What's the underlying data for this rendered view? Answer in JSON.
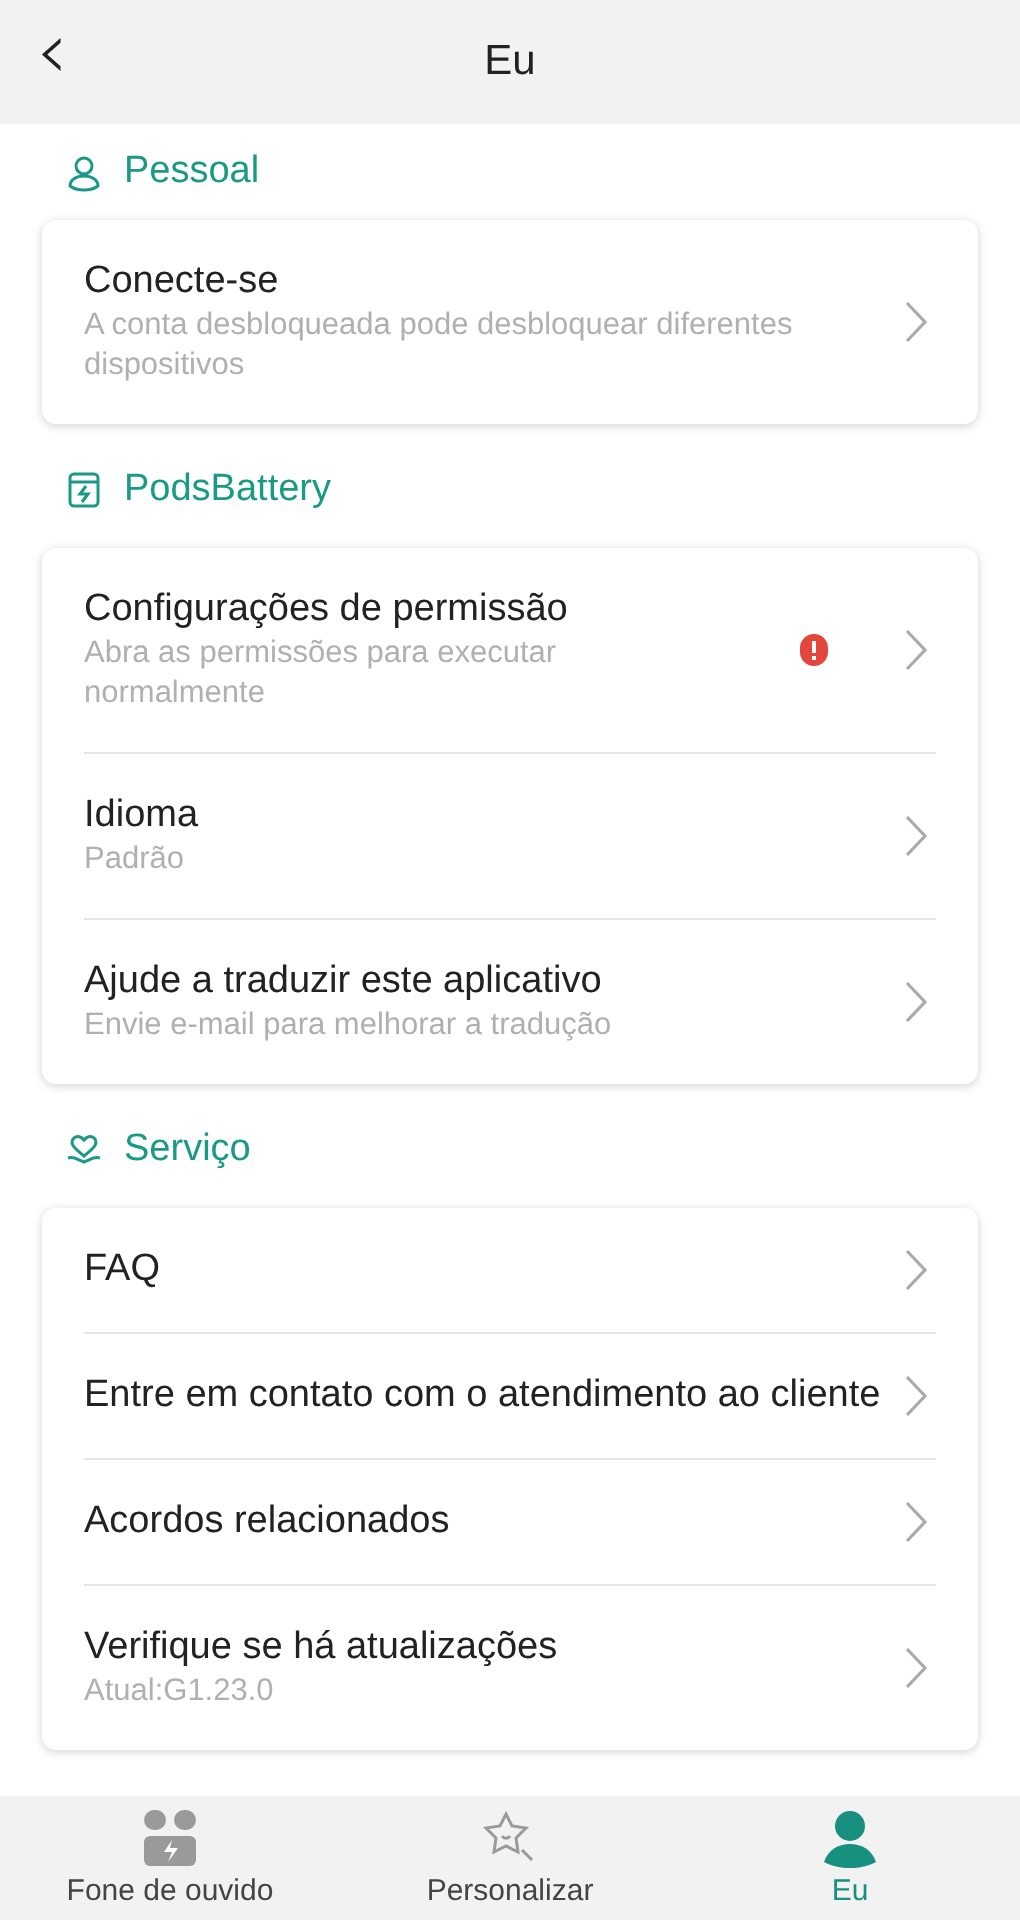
{
  "header": {
    "back": "‹",
    "title": "Eu"
  },
  "sections": [
    {
      "kind": "person",
      "title": "Pessoal",
      "items": [
        {
          "title": "Conecte-se",
          "subtitle": "A conta desbloqueada pode desbloquear diferentes dispositivos",
          "alert": false
        }
      ]
    },
    {
      "kind": "battery",
      "title": "PodsBattery",
      "items": [
        {
          "title": "Configurações de permissão",
          "subtitle": "Abra as permissões para executar normalmente",
          "alert": true
        },
        {
          "title": "Idioma",
          "subtitle": "Padrão",
          "alert": false
        },
        {
          "title": "Ajude a traduzir este aplicativo",
          "subtitle": "Envie e-mail para melhorar a tradução",
          "alert": false
        }
      ]
    },
    {
      "kind": "heart",
      "title": "Serviço",
      "items": [
        {
          "title": "FAQ",
          "alert": false
        },
        {
          "title": "Entre em contato com o atendimento ao cliente",
          "alert": false
        },
        {
          "title": "Acordos relacionados",
          "alert": false
        },
        {
          "title": "Verifique se há atualizações",
          "subtitle": "Atual:G1.23.0",
          "alert": false
        }
      ]
    }
  ],
  "tabs": [
    {
      "kind": "earbuds",
      "label": "Fone de ouvido",
      "selected": false
    },
    {
      "kind": "star",
      "label": "Personalizar",
      "selected": false
    },
    {
      "kind": "profile",
      "label": "Eu",
      "selected": true
    }
  ]
}
